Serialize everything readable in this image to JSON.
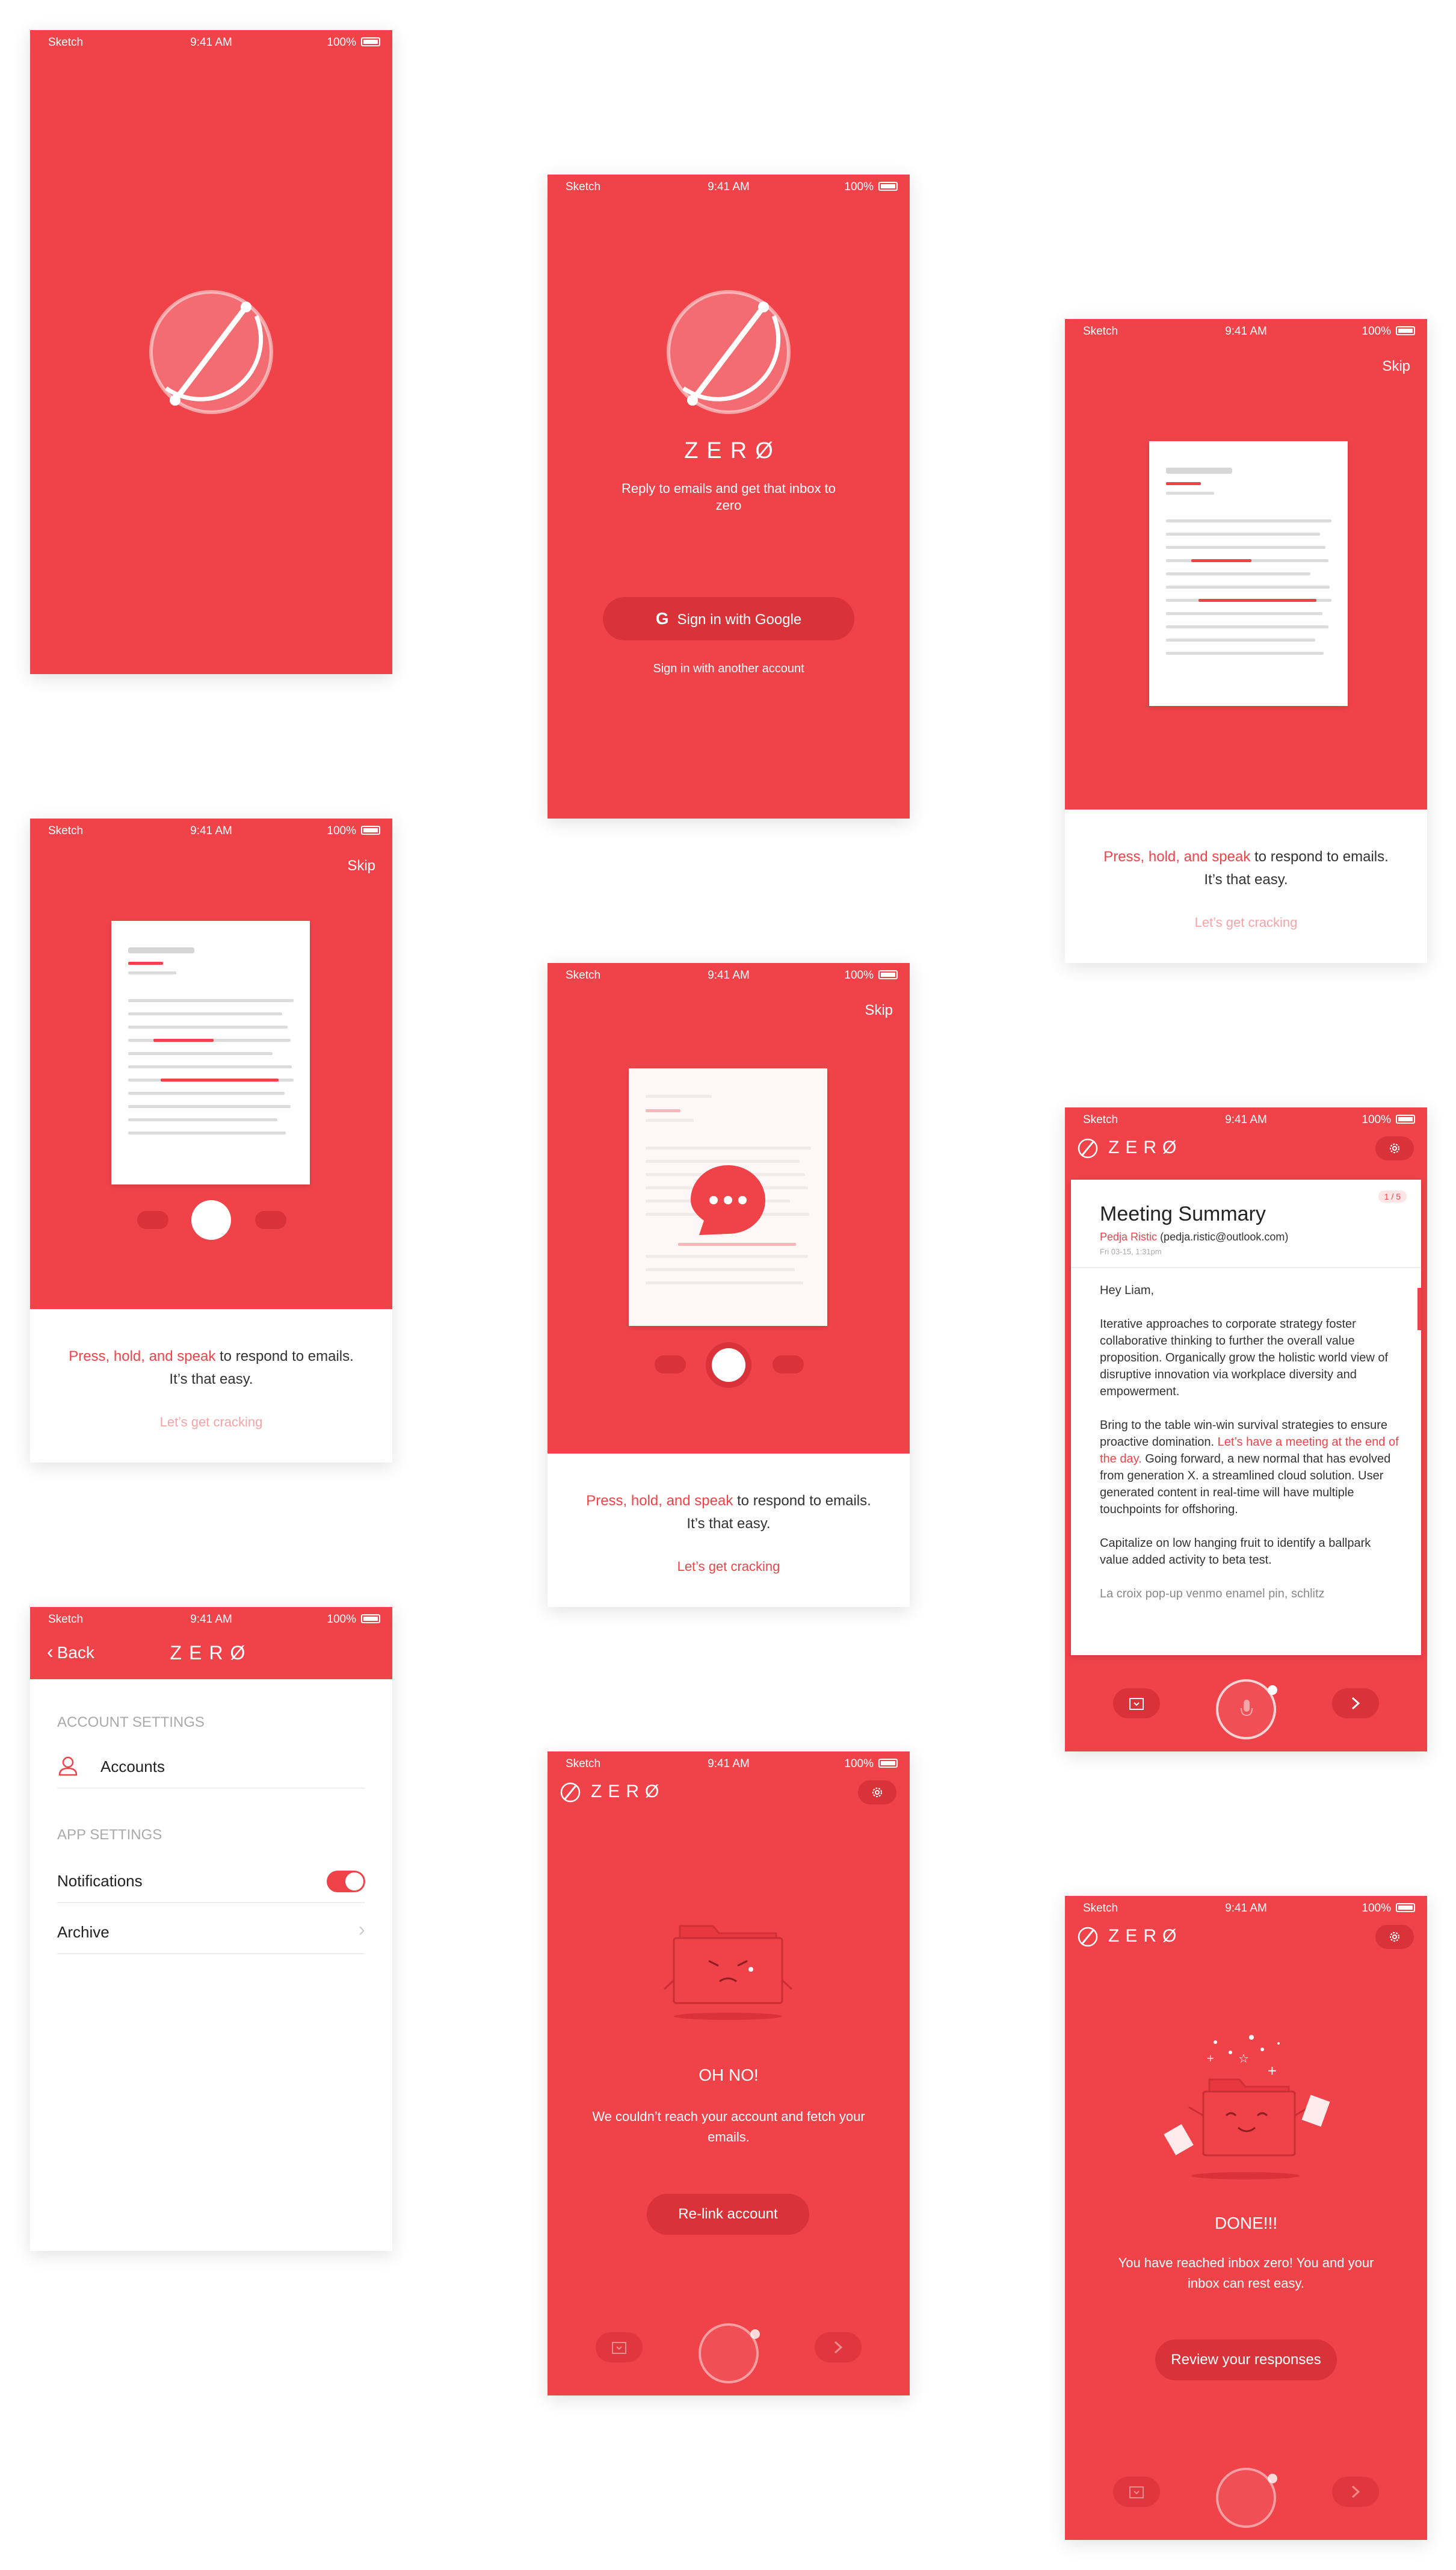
{
  "status": {
    "carrier": "Sketch",
    "time": "9:41 AM",
    "battery": "100%"
  },
  "brand": {
    "name": "ZERØ",
    "tagline": "Reply to emails and get that inbox to zero"
  },
  "signin": {
    "google": "Sign in with Google",
    "other": "Sign in with another account"
  },
  "onboarding": {
    "skip": "Skip",
    "press_highlight": "Press, hold, and speak",
    "press_rest": "to respond to emails.",
    "easy": "It’s that easy.",
    "cta": "Let’s get cracking"
  },
  "settings": {
    "back": "Back",
    "title": "ZERØ",
    "account_header": "ACCOUNT SETTINGS",
    "accounts": "Accounts",
    "app_header": "APP SETTINGS",
    "notifications": "Notifications",
    "notifications_on": true,
    "archive": "Archive"
  },
  "email": {
    "subject": "Meeting Summary",
    "counter": "1 / 5",
    "sender": "Pedja Ristic",
    "sender_email": "(pedja.ristic@outlook.com)",
    "date": "Fri 03-15, 1:31pm",
    "greeting": "Hey Liam,",
    "p1": "Iterative approaches to corporate strategy foster collaborative thinking to further the overall value proposition. Organically grow the holistic world view of disruptive innovation via workplace diversity and empowerment.",
    "p2a": "Bring to the table win-win survival strategies to ensure proactive domination.",
    "p2_highlight": "Let’s have a meeting at the end of the day.",
    "p2b": "Going forward, a new normal that has evolved from generation X. a streamlined cloud solution. User generated content in real-time will have multiple touchpoints for offshoring.",
    "p3": "Capitalize on low hanging fruit to identify a ballpark value added activity to beta test.",
    "p4": "La croix pop-up venmo enamel pin, schlitz"
  },
  "error": {
    "title": "OH NO!",
    "message": "We couldn’t reach your account and fetch your emails.",
    "button": "Re-link account"
  },
  "done": {
    "title": "DONE!!!",
    "message": "You have reached inbox zero! You and your inbox can rest easy.",
    "button": "Review your responses"
  },
  "colors": {
    "accent": "#ef4349",
    "dark_accent": "#d93238",
    "highlight_text": "#ef4349"
  }
}
